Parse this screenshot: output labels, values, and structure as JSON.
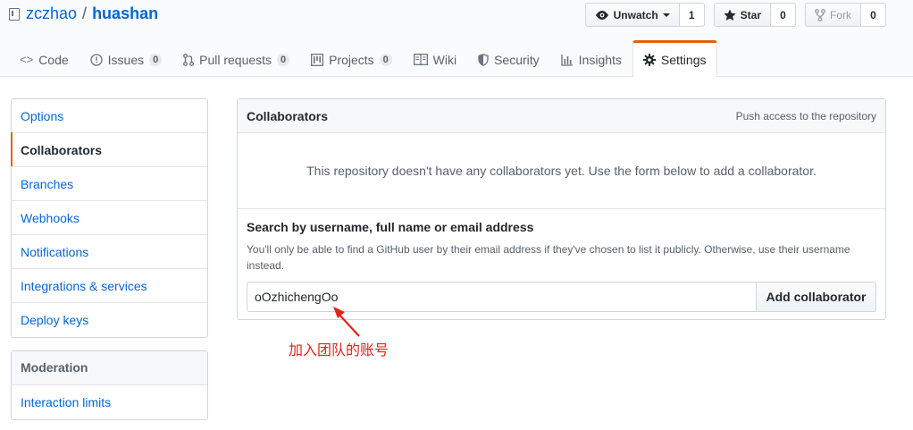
{
  "repo": {
    "owner": "zczhao",
    "separator": "/",
    "name": "huashan"
  },
  "actions": [
    {
      "label": "Unwatch",
      "count": "1"
    },
    {
      "label": "Star",
      "count": "0"
    },
    {
      "label": "Fork",
      "count": "0"
    }
  ],
  "tabs": [
    {
      "label": "Code",
      "icon": "code-icon"
    },
    {
      "label": "Issues",
      "badge": "0",
      "icon": "issue-icon"
    },
    {
      "label": "Pull requests",
      "badge": "0",
      "icon": "pull-request-icon"
    },
    {
      "label": "Projects",
      "badge": "0",
      "icon": "project-icon"
    },
    {
      "label": "Wiki",
      "icon": "book-icon"
    },
    {
      "label": "Security",
      "icon": "shield-icon"
    },
    {
      "label": "Insights",
      "icon": "graph-icon"
    },
    {
      "label": "Settings",
      "icon": "gear-icon",
      "selected": true
    }
  ],
  "sidebar": {
    "items": [
      "Options",
      "Collaborators",
      "Branches",
      "Webhooks",
      "Notifications",
      "Integrations & services",
      "Deploy keys"
    ],
    "selected": "Collaborators",
    "moderation": {
      "heading": "Moderation",
      "items": [
        "Interaction limits"
      ]
    }
  },
  "collaborators": {
    "title": "Collaborators",
    "note": "Push access to the repository",
    "empty_message": "This repository doesn't have any collaborators yet. Use the form below to add a collaborator.",
    "search_label": "Search by username, full name or email address",
    "search_note": "You'll only be able to find a GitHub user by their email address if they've chosen to list it publicly. Otherwise, use their username instead.",
    "search_value": "oOzhichengOo",
    "add_button": "Add collaborator"
  },
  "annotation": {
    "text": "加入团队的账号",
    "color": "#e2231a"
  },
  "colors": {
    "accent": "#e36209",
    "link": "#0366d6"
  }
}
